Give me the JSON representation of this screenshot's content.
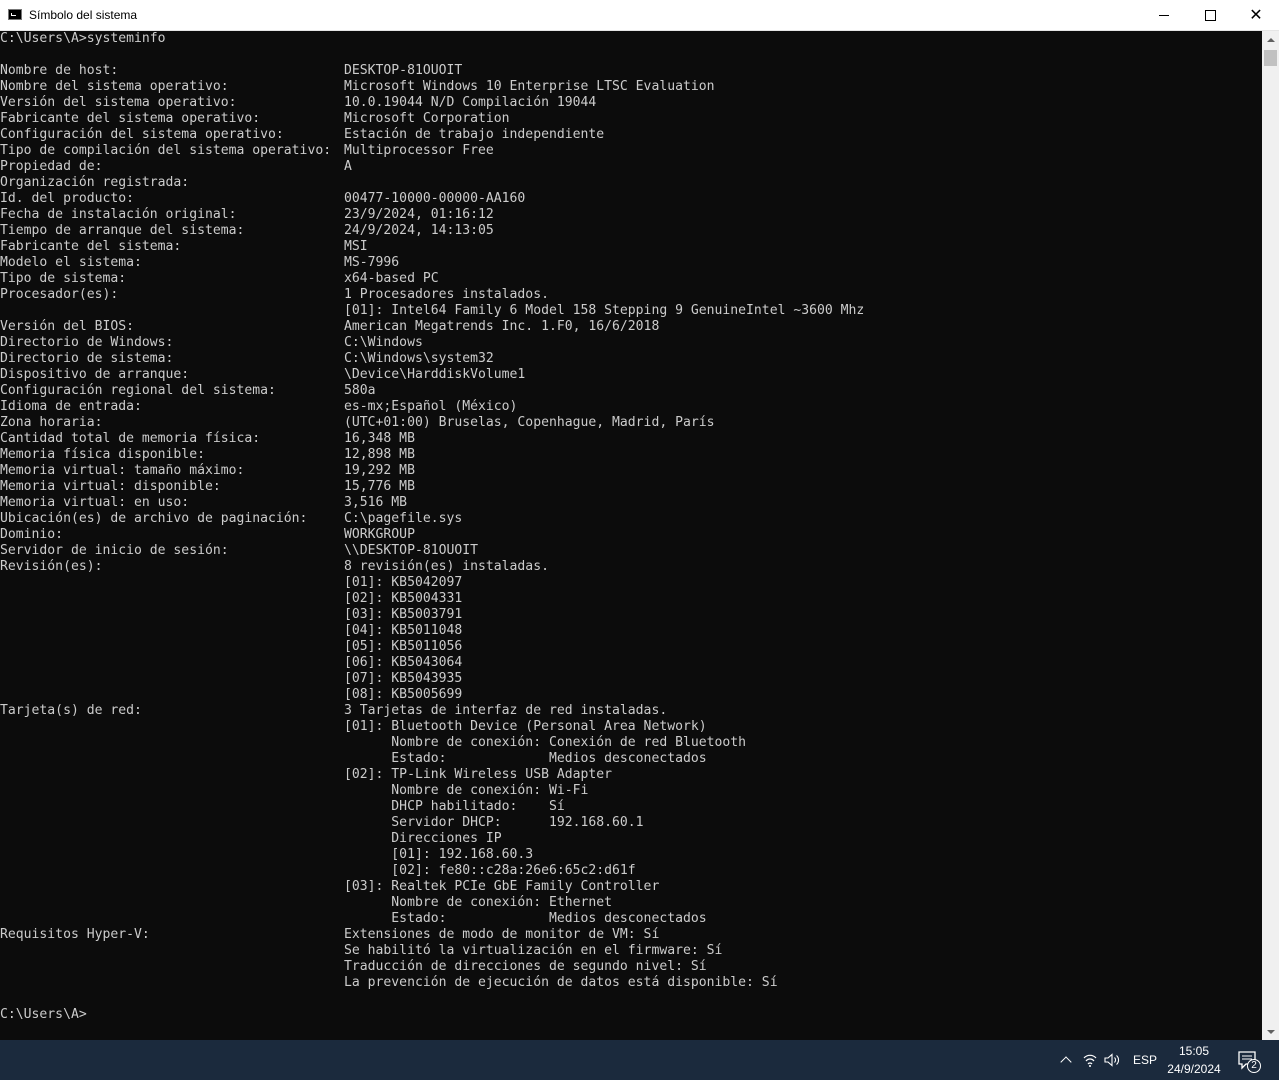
{
  "window": {
    "title": "Símbolo del sistema",
    "controls": {
      "minimize": "minimize-icon",
      "maximize": "maximize-icon",
      "close": "close-icon"
    }
  },
  "console": {
    "text_color": "#cccccc",
    "background": "#0c0c0c",
    "lines": [
      [
        "C:\\Users\\A>systeminfo",
        ""
      ],
      [
        "",
        ""
      ],
      [
        "Nombre de host:",
        "DESKTOP-81OUOIT"
      ],
      [
        "Nombre del sistema operativo:",
        "Microsoft Windows 10 Enterprise LTSC Evaluation"
      ],
      [
        "Versión del sistema operativo:",
        "10.0.19044 N/D Compilación 19044"
      ],
      [
        "Fabricante del sistema operativo:",
        "Microsoft Corporation"
      ],
      [
        "Configuración del sistema operativo:",
        "Estación de trabajo independiente"
      ],
      [
        "Tipo de compilación del sistema operativo:",
        "Multiprocessor Free"
      ],
      [
        "Propiedad de:",
        "A"
      ],
      [
        "Organización registrada:",
        ""
      ],
      [
        "Id. del producto:",
        "00477-10000-00000-AA160"
      ],
      [
        "Fecha de instalación original:",
        "23/9/2024, 01:16:12"
      ],
      [
        "Tiempo de arranque del sistema:",
        "24/9/2024, 14:13:05"
      ],
      [
        "Fabricante del sistema:",
        "MSI"
      ],
      [
        "Modelo el sistema:",
        "MS-7996"
      ],
      [
        "Tipo de sistema:",
        "x64-based PC"
      ],
      [
        "Procesador(es):",
        "1 Procesadores instalados."
      ],
      [
        "",
        "[01]: Intel64 Family 6 Model 158 Stepping 9 GenuineIntel ~3600 Mhz"
      ],
      [
        "Versión del BIOS:",
        "American Megatrends Inc. 1.F0, 16/6/2018"
      ],
      [
        "Directorio de Windows:",
        "C:\\Windows"
      ],
      [
        "Directorio de sistema:",
        "C:\\Windows\\system32"
      ],
      [
        "Dispositivo de arranque:",
        "\\Device\\HarddiskVolume1"
      ],
      [
        "Configuración regional del sistema:",
        "580a"
      ],
      [
        "Idioma de entrada:",
        "es-mx;Español (México)"
      ],
      [
        "Zona horaria:",
        "(UTC+01:00) Bruselas, Copenhague, Madrid, París"
      ],
      [
        "Cantidad total de memoria física:",
        "16,348 MB"
      ],
      [
        "Memoria física disponible:",
        "12,898 MB"
      ],
      [
        "Memoria virtual: tamaño máximo:",
        "19,292 MB"
      ],
      [
        "Memoria virtual: disponible:",
        "15,776 MB"
      ],
      [
        "Memoria virtual: en uso:",
        "3,516 MB"
      ],
      [
        "Ubicación(es) de archivo de paginación:",
        "C:\\pagefile.sys"
      ],
      [
        "Dominio:",
        "WORKGROUP"
      ],
      [
        "Servidor de inicio de sesión:",
        "\\\\DESKTOP-81OUOIT"
      ],
      [
        "Revisión(es):",
        "8 revisión(es) instaladas."
      ],
      [
        "",
        "[01]: KB5042097"
      ],
      [
        "",
        "[02]: KB5004331"
      ],
      [
        "",
        "[03]: KB5003791"
      ],
      [
        "",
        "[04]: KB5011048"
      ],
      [
        "",
        "[05]: KB5011056"
      ],
      [
        "",
        "[06]: KB5043064"
      ],
      [
        "",
        "[07]: KB5043935"
      ],
      [
        "",
        "[08]: KB5005699"
      ],
      [
        "Tarjeta(s) de red:",
        "3 Tarjetas de interfaz de red instaladas."
      ],
      [
        "",
        "[01]: Bluetooth Device (Personal Area Network)"
      ],
      [
        "",
        "      Nombre de conexión: Conexión de red Bluetooth"
      ],
      [
        "",
        "      Estado:             Medios desconectados"
      ],
      [
        "",
        "[02]: TP-Link Wireless USB Adapter"
      ],
      [
        "",
        "      Nombre de conexión: Wi-Fi"
      ],
      [
        "",
        "      DHCP habilitado:    Sí"
      ],
      [
        "",
        "      Servidor DHCP:      192.168.60.1"
      ],
      [
        "",
        "      Direcciones IP"
      ],
      [
        "",
        "      [01]: 192.168.60.3"
      ],
      [
        "",
        "      [02]: fe80::c28a:26e6:65c2:d61f"
      ],
      [
        "",
        "[03]: Realtek PCIe GbE Family Controller"
      ],
      [
        "",
        "      Nombre de conexión: Ethernet"
      ],
      [
        "",
        "      Estado:             Medios desconectados"
      ],
      [
        "Requisitos Hyper-V:",
        "Extensiones de modo de monitor de VM: Sí"
      ],
      [
        "",
        "Se habilitó la virtualización en el firmware: Sí"
      ],
      [
        "",
        "Traducción de direcciones de segundo nivel: Sí"
      ],
      [
        "",
        "La prevención de ejecución de datos está disponible: Sí"
      ],
      [
        "",
        ""
      ],
      [
        "C:\\Users\\A>",
        ""
      ]
    ]
  },
  "taskbar": {
    "background": "#1b2a3d",
    "tray_icons": [
      "chevron-up-icon",
      "network-icon",
      "volume-icon"
    ],
    "language": "ESP",
    "time": "15:05",
    "date": "24/9/2024",
    "notification_count": "2"
  }
}
